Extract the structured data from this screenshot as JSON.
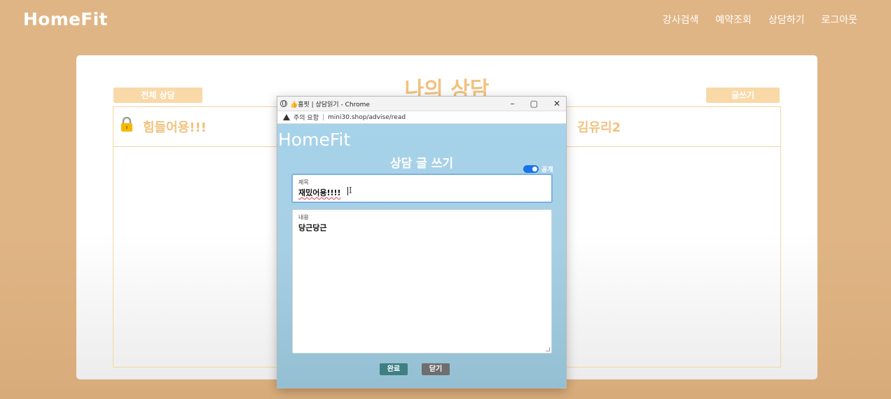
{
  "header": {
    "brand": "HomeFit",
    "nav": [
      "강사검색",
      "예약조회",
      "상담하기",
      "로그아웃"
    ]
  },
  "main": {
    "title": "나의 상담",
    "all_button": "전체 상담",
    "write_button": "글쓰기",
    "rows": [
      {
        "title": "힘들어용!!!",
        "author": "김유리2",
        "locked": true
      }
    ]
  },
  "popup": {
    "window_title": "👍홈핏 | 상담읽기 - Chrome",
    "security": "주의 요함",
    "url": "mini30.shop/advise/read",
    "controls": {
      "minimize": "–",
      "maximize": "▢",
      "close": "✕"
    },
    "brand": "HomeFit",
    "heading": "상담 글 쓰기",
    "public_toggle": {
      "label": "공개",
      "on": true
    },
    "title_field": {
      "label": "제목",
      "value": "재밌어용!!!!"
    },
    "content_field": {
      "label": "내용",
      "value": "당근당근"
    },
    "done_button": "완료",
    "close_button": "닫기"
  },
  "colors": {
    "background": "#e0b585",
    "accent_text": "#f1c27f",
    "popup_bg": "#a6d2ea",
    "done_button": "#3f7f84",
    "close_button": "#6e6e6e",
    "toggle_on": "#1a73e8"
  }
}
